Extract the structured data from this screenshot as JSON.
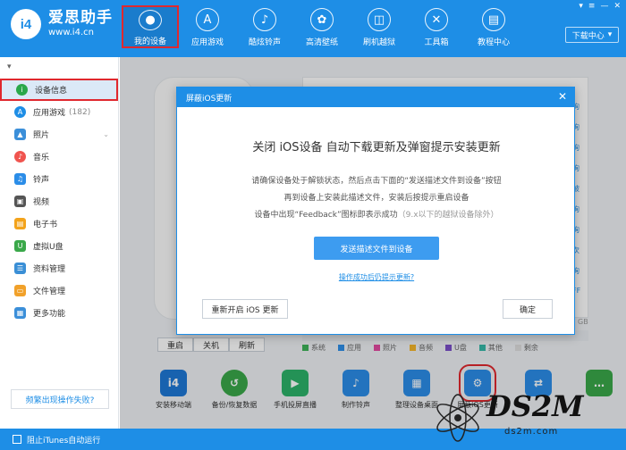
{
  "app": {
    "logo_badge": "i4",
    "name": "爱思助手",
    "url": "www.i4.cn"
  },
  "nav": [
    {
      "label": "我的设备",
      "icon": "apple-icon",
      "active": true
    },
    {
      "label": "应用游戏",
      "icon": "app-store-icon"
    },
    {
      "label": "酷炫铃声",
      "icon": "bell-icon"
    },
    {
      "label": "高清壁纸",
      "icon": "flower-icon"
    },
    {
      "label": "刷机越狱",
      "icon": "box-icon"
    },
    {
      "label": "工具箱",
      "icon": "tools-icon"
    },
    {
      "label": "教程中心",
      "icon": "book-icon"
    }
  ],
  "header": {
    "download_label": "下载中心"
  },
  "sidebar": {
    "items": [
      {
        "label": "设备信息",
        "icon": "info-icon",
        "color": "#2aa84a",
        "active": true
      },
      {
        "label": "应用游戏",
        "count": "(182)",
        "icon": "app-store-icon",
        "color": "#1e8ee6"
      },
      {
        "label": "照片",
        "icon": "photo-icon",
        "color": "#3b8fd9"
      },
      {
        "label": "音乐",
        "icon": "music-icon",
        "color": "#f0544f"
      },
      {
        "label": "铃声",
        "icon": "bell-icon",
        "color": "#2b8de8"
      },
      {
        "label": "视频",
        "icon": "video-icon",
        "color": "#555555"
      },
      {
        "label": "电子书",
        "icon": "book-icon",
        "color": "#f3a31b"
      },
      {
        "label": "虚拟U盘",
        "icon": "usb-icon",
        "color": "#3aa84a"
      },
      {
        "label": "资料管理",
        "icon": "contacts-icon",
        "color": "#3a8fd6"
      },
      {
        "label": "文件管理",
        "icon": "folder-icon",
        "color": "#f1a12a"
      },
      {
        "label": "更多功能",
        "icon": "grid-icon",
        "color": "#3b8fd9"
      }
    ],
    "help_label": "频繁出现操作失败?"
  },
  "device": {
    "buttons": [
      "重启",
      "关机",
      "刷新"
    ],
    "storage_unit": "GB",
    "side_labels": [
      "询",
      "询",
      "询",
      "询",
      "被",
      "询",
      "询",
      "次",
      "询",
      "FF"
    ]
  },
  "legend": [
    {
      "label": "系统",
      "color": "#3fb25a"
    },
    {
      "label": "应用",
      "color": "#2f8fe8"
    },
    {
      "label": "照片",
      "color": "#e24aa0"
    },
    {
      "label": "音频",
      "color": "#f3b52a"
    },
    {
      "label": "U盘",
      "color": "#7a4fc8"
    },
    {
      "label": "其他",
      "color": "#36b8a8"
    },
    {
      "label": "剩余",
      "color": "#dddddd"
    }
  ],
  "tools": [
    {
      "label": "安装移动端",
      "color": "#1e78d6",
      "glyph": "i4"
    },
    {
      "label": "备份/恢复数据",
      "color": "#3aa84a",
      "glyph": "↺"
    },
    {
      "label": "手机投屏直播",
      "color": "#2db36a",
      "glyph": "▶"
    },
    {
      "label": "制作铃声",
      "color": "#2b8de8",
      "glyph": "♪"
    },
    {
      "label": "整理设备桌面",
      "color": "#2b8de8",
      "glyph": "▦"
    },
    {
      "label": "屏蔽iOS更新",
      "color": "#2b8de8",
      "glyph": "⚙",
      "highlight": true
    },
    {
      "label": "",
      "color": "#2b8de8",
      "glyph": "⇄"
    },
    {
      "label": "",
      "color": "#3aa84a",
      "glyph": "…"
    }
  ],
  "modal": {
    "header": "屏蔽iOS更新",
    "title": "关闭 iOS设备 自动下载更新及弹窗提示安装更新",
    "line1": "请确保设备处于解锁状态，然后点击下面的“发送描述文件到设备”按钮",
    "line2": "再到设备上安装此描述文件，安装后按提示重启设备",
    "line3_main": "设备中出现“Feedback”图标即表示成功",
    "line3_muted": "（9.x以下的越狱设备除外）",
    "primary_button": "发送描述文件到设备",
    "link": "操作成功后仍提示更新?",
    "left_button": "重新开启 iOS 更新",
    "ok_button": "确定"
  },
  "statusbar": {
    "label": "阻止iTunes自动运行"
  },
  "watermark": {
    "brand": "DS2M",
    "sub": "ds2m.com"
  }
}
